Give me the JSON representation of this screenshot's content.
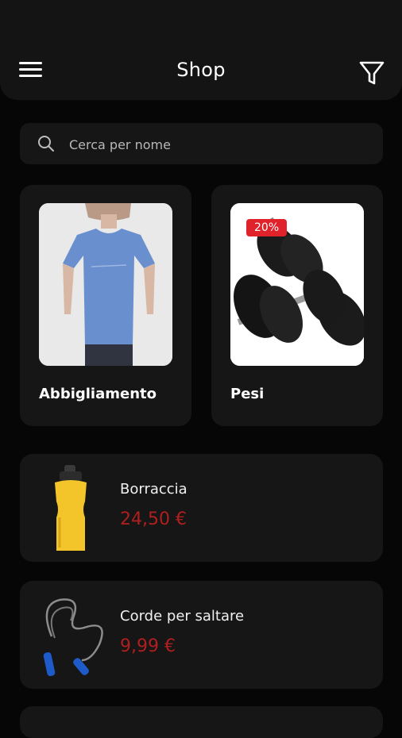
{
  "header": {
    "title": "Shop",
    "menu_icon": "hamburger-icon",
    "filter_icon": "funnel-icon"
  },
  "search": {
    "placeholder": "Cerca per nome",
    "value": "",
    "icon": "search-icon"
  },
  "categories": [
    {
      "label": "Abbigliamento"
    },
    {
      "label": "Pesi",
      "badge": "20%"
    }
  ],
  "products": [
    {
      "name": "Borraccia",
      "price": "24,50 €"
    },
    {
      "name": "Corde per saltare",
      "price": "9,99 €"
    }
  ],
  "colors": {
    "background": "#060606",
    "card": "#161616",
    "price": "#b01f1f",
    "badge": "#e0222b"
  }
}
